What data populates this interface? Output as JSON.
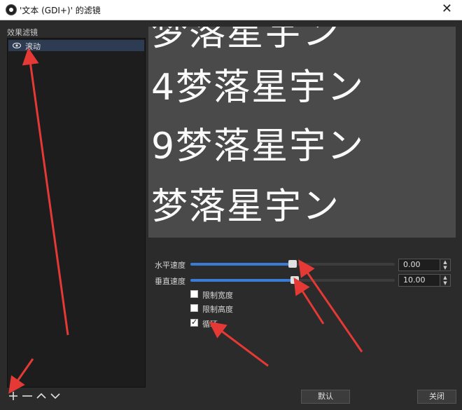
{
  "window": {
    "title": "'文本 (GDI+)' 的滤镜",
    "close_glyph": "✕"
  },
  "filters_panel": {
    "header": "效果滤镜",
    "items": [
      {
        "label": "滚动",
        "icon": "eye-icon"
      }
    ]
  },
  "preview": {
    "lines": [
      "梦落星宇ン",
      "4梦落星宇ン",
      "9梦落星宇ン",
      "梦落星宇ン"
    ]
  },
  "properties": {
    "horizontal_speed": {
      "label": "水平速度",
      "value": "0.00",
      "level_percent": 50
    },
    "vertical_speed": {
      "label": "垂直速度",
      "value": "10.00",
      "level_percent": 51
    },
    "limit_width": {
      "label": "限制宽度",
      "checked": false
    },
    "limit_height": {
      "label": "限制高度",
      "checked": false
    },
    "loop": {
      "label": "循环",
      "checked": true
    }
  },
  "toolbar": {
    "add_icon": "plus-icon",
    "remove_icon": "minus-icon",
    "move_up_icon": "chevron-up-icon",
    "move_down_icon": "chevron-down-icon"
  },
  "buttons": {
    "defaults": "默认",
    "close": "关闭"
  },
  "colors": {
    "accent": "#3a7bd5",
    "annotation": "#e53935",
    "background": "#2b2b2b"
  }
}
